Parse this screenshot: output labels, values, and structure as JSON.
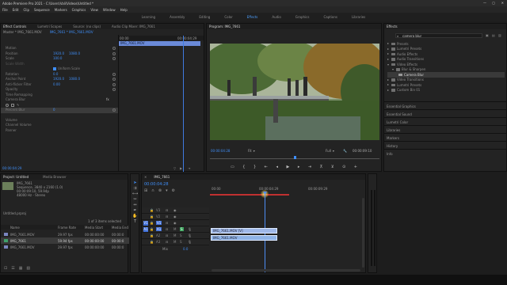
{
  "app": {
    "title": "Adobe Premiere Pro 2021 - C:\\Users\\Vali\\Videos\\Untitled *"
  },
  "menu": [
    "File",
    "Edit",
    "Clip",
    "Sequence",
    "Markers",
    "Graphics",
    "View",
    "Window",
    "Help"
  ],
  "workspaces": {
    "items": [
      "Learning",
      "Assembly",
      "Editing",
      "Color",
      "Effects",
      "Audio",
      "Graphics",
      "Captions",
      "Libraries"
    ],
    "active": "Effects"
  },
  "effect_controls": {
    "tabs": [
      "Effect Controls",
      "Lumetri Scopes",
      "Source: (no clips)",
      "Audio Clip Mixer: IMG_7661"
    ],
    "master": "Master * IMG_7661.MOV",
    "seq": "IMG_7661 * IMG_7661.MOV",
    "clip_label": "IMG_7661.MOV",
    "ruler_start": "00:00",
    "ruler_mid": "00:00:04:29",
    "motion": "Motion",
    "position": {
      "label": "Position",
      "x": "1920.0",
      "y": "1080.0"
    },
    "scale": {
      "label": "Scale",
      "value": "100.0"
    },
    "scale_width": "Scale Width",
    "uniform": "Uniform Scale",
    "rotation": {
      "label": "Rotation",
      "value": "0.0"
    },
    "anchor": {
      "label": "Anchor Point",
      "x": "1920.0",
      "y": "1080.0"
    },
    "flicker": {
      "label": "Anti-flicker Filter",
      "value": "0.00"
    },
    "opacity": "Opacity",
    "time_remap": "Time Remapping",
    "camera_blur": {
      "label": "Camera Blur",
      "value": "0"
    },
    "percent_blur": "Percent Blur",
    "volume": "Volume",
    "channel_volume": "Channel Volume",
    "panner": "Panner",
    "footer_time": "00:00:04:29"
  },
  "program": {
    "title": "Program: IMG_7661",
    "timecode": "00:00:04:28",
    "zoom": "Fit",
    "quality": "Full",
    "duration": "00:00:09:10"
  },
  "effects": {
    "title": "Effects",
    "search": "camera blur",
    "tree": [
      {
        "label": "Presets",
        "indent": 0,
        "open": false
      },
      {
        "label": "Lumetri Presets",
        "indent": 0,
        "open": false
      },
      {
        "label": "Audio Effects",
        "indent": 0,
        "open": false
      },
      {
        "label": "Audio Transitions",
        "indent": 0,
        "open": false
      },
      {
        "label": "Video Effects",
        "indent": 0,
        "open": true
      },
      {
        "label": "Blur & Sharpen",
        "indent": 1,
        "open": true
      },
      {
        "label": "Camera Blur",
        "indent": 2,
        "open": false,
        "selected": true
      },
      {
        "label": "Video Transitions",
        "indent": 0,
        "open": false
      },
      {
        "label": "Lumetri Presets",
        "indent": 0,
        "open": false
      },
      {
        "label": "Custom Bin 01",
        "indent": 0,
        "open": false
      }
    ],
    "panels": [
      "Essential Graphics",
      "Essential Sound",
      "Lumetri Color",
      "Libraries",
      "Markers",
      "History",
      "Info"
    ]
  },
  "project": {
    "tabs": [
      "Project: Untitled",
      "Media Browser"
    ],
    "clip_name": "IMG_7661",
    "clip_info": "Sequence, 3840 x 2160 (1.0)",
    "clip_time": "00:00:09:10, 59.94p",
    "clip_audio": "48000 Hz - Stereo",
    "path": "Untitled.prproj",
    "selected_count": "1 of 3 items selected",
    "columns": [
      "Name",
      "Frame Rate",
      "Media Start",
      "Media End"
    ],
    "rows": [
      {
        "name": "IMG_7661.MOV",
        "rate": "29.97 fps",
        "start": "00:00:00:00",
        "end": "00:00:0"
      },
      {
        "name": "IMG_7661",
        "rate": "59.94 fps",
        "start": "00:00:00:00",
        "end": "00:00:0"
      },
      {
        "name": "IMG_7661.MOV",
        "rate": "29.97 fps",
        "start": "00:00:00:00",
        "end": "00:00:0"
      }
    ]
  },
  "timeline": {
    "tab": "IMG_7661",
    "timecode": "00:00:04:28",
    "ruler": [
      "00:00",
      "00:00:04:29",
      "00:00:09:29"
    ],
    "tracks": [
      "V3",
      "V2",
      "V1",
      "A1",
      "A2",
      "A3"
    ],
    "clip_v": "IMG_7661.MOV [V]",
    "clip_a": "IMG_7661.MOV",
    "mix_label": "Mix",
    "mix_value": "0.0"
  },
  "colors": {
    "accent": "#3f8ef7",
    "playhead": "#4e8ef6",
    "work_bar": "#d03030"
  }
}
